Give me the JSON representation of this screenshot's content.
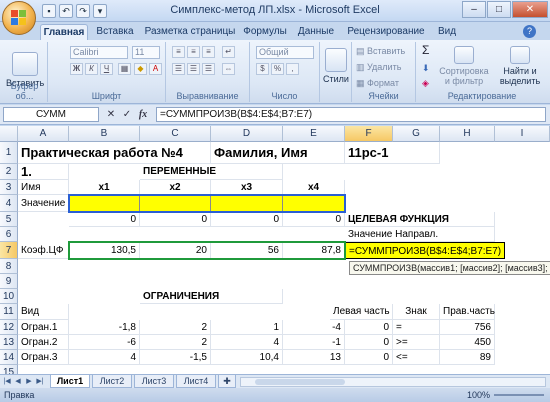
{
  "window": {
    "title": "Симплекс-метод ЛП.xlsx - Microsoft Excel",
    "controls": [
      "–",
      "□",
      "✕"
    ],
    "help": "?"
  },
  "ribbon": {
    "tabs": [
      "Главная",
      "Вставка",
      "Разметка страницы",
      "Формулы",
      "Данные",
      "Рецензирование",
      "Вид"
    ],
    "paste_label": "Вставить",
    "font_name": "Calibri",
    "font_size": "11",
    "bold": "Ж",
    "italic": "К",
    "underline": "Ч",
    "number_format": "Общий",
    "styles_label": "Стили",
    "cells_insert": "Вставить",
    "cells_delete": "Удалить",
    "cells_format": "Формат",
    "sum_sym": "Σ",
    "sort_label": "Сортировка и фильтр",
    "find_label": "Найти и выделить",
    "groups": [
      "Буфер об...",
      "Шрифт",
      "Выравнивание",
      "Число",
      "Ячейки",
      "Редактирование"
    ]
  },
  "formula_bar": {
    "name_box": "СУММ",
    "cancel": "✕",
    "enter": "✓",
    "fx": "fx",
    "formula": "=СУММПРОИЗВ(B$4:E$4;B7:E7)"
  },
  "grid": {
    "columns": [
      "A",
      "B",
      "C",
      "D",
      "E",
      "F",
      "G",
      "H",
      "I"
    ],
    "rows": [
      "1",
      "2",
      "3",
      "4",
      "5",
      "6",
      "7",
      "8",
      "9",
      "10",
      "11",
      "12",
      "13",
      "14",
      "15"
    ],
    "cells": {
      "A1": "Практическая работа №4",
      "D1": "Фамилия, Имя",
      "F1": "11рс-1",
      "A2": "1.",
      "C2": "ПЕРЕМЕННЫЕ",
      "A3": "Имя",
      "B3": "x1",
      "C3": "x2",
      "D3": "x3",
      "E3": "x4",
      "A4": "Значение",
      "B5": "0",
      "C5": "0",
      "D5": "0",
      "E5": "0",
      "F5": "ЦЕЛЕВАЯ ФУНКЦИЯ",
      "F6": "Значение Направл.",
      "A7": "Коэф.ЦФ",
      "B7": "130,5",
      "C7": "20",
      "D7": "56",
      "E7": "87,8",
      "F7": "=СУММПРОИЗВ(B$4:E$4;B7:E7)",
      "C10": "ОГРАНИЧЕНИЯ",
      "A11": "Вид",
      "F11": "Левая часть",
      "G11": "Знак",
      "H11": "Прав.часть",
      "A12": "Огран.1",
      "B12": "-1,8",
      "C12": "2",
      "D12": "1",
      "E12": "-4",
      "F12": "0",
      "G12": "=",
      "H12": "756",
      "A13": "Огран.2",
      "B13": "-6",
      "C13": "2",
      "D13": "4",
      "E13": "-1",
      "F13": "0",
      "G13": ">=",
      "H13": "450",
      "A14": "Огран.3",
      "B14": "4",
      "C14": "-1,5",
      "D14": "10,4",
      "E14": "13",
      "F14": "0",
      "G14": "<=",
      "H14": "89"
    },
    "tooltip": "СУММПРОИЗВ(массив1; [массив2]; [массив3]; [массив4]; ...)"
  },
  "sheets": [
    "Лист1",
    "Лист2",
    "Лист3",
    "Лист4"
  ],
  "status": {
    "mode": "Правка",
    "zoom": "100%"
  },
  "colors": {
    "highlight": "#ffff00",
    "selected_header": "#f6c865",
    "ref_blue": "#2a5fd4",
    "ref_green": "#1f9a3b"
  }
}
